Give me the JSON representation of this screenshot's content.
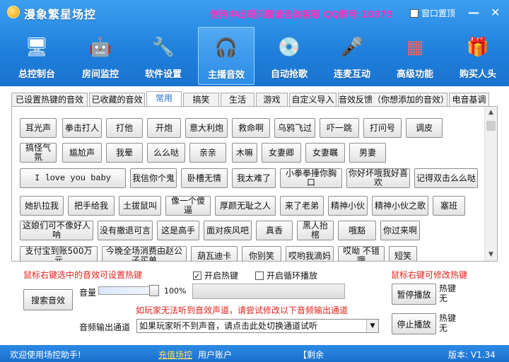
{
  "window": {
    "title": "漫象繁星场控",
    "notice": "使用中出现问题请咨询客服 QQ群号:10375",
    "topmost_label": "窗口置顶",
    "minimize": "—",
    "close": "✕"
  },
  "nav": [
    {
      "label": "总控制台",
      "icon": "🖥",
      "color": "#ffffff"
    },
    {
      "label": "房间监控",
      "icon": "🤖",
      "color": "#ffd44a"
    },
    {
      "label": "软件设置",
      "icon": "🔧",
      "color": "#ffcf3a"
    },
    {
      "label": "主播音效",
      "icon": "🎧",
      "color": "#ffffff"
    },
    {
      "label": "自动抢歌",
      "icon": "💿",
      "color": "#ffffff"
    },
    {
      "label": "连麦互动",
      "icon": "🎤",
      "color": "#ffffff"
    },
    {
      "label": "高级功能",
      "icon": "▦",
      "color": "#ff5a6a"
    },
    {
      "label": "购买人头",
      "icon": "🎁",
      "color": "#ffffff"
    }
  ],
  "tabs": [
    "已设置热键的音效",
    "已收藏的音效",
    "常用",
    "搞笑",
    "生活",
    "游戏",
    "自定义导入",
    "音效反馈（你想添加的音效）",
    "电音基调"
  ],
  "sounds": [
    [
      "耳光声",
      "拳击打人",
      "打他",
      "开炮",
      "意大利炮",
      "救命啊",
      "乌鸦飞过",
      "吓一跳",
      "打问号",
      "调皮"
    ],
    [
      "搞怪气氛",
      "尴尬声",
      "我晕",
      "么么哒",
      "亲亲",
      "木嘛",
      "女妻卿",
      "女妻瞩",
      "男妻"
    ],
    [
      "I love you baby",
      "我信你个鬼",
      "卧槽无情",
      "我太难了",
      "小拳拳捶你胸口",
      "你好坏哦我好喜欢",
      "记得双击么么哒"
    ],
    [
      "她扒拉我",
      "把手给我",
      "土拔鼠叫",
      "像一个傻逼",
      "厚颜无耻之人",
      "来了老弟",
      "精神小伙",
      "精神小伙之歌",
      "塞班"
    ],
    [
      "这娘们可不像好人呐",
      "没有撤退可言",
      "这是高手",
      "面对疾风吧",
      "真香",
      "黑人抬棺",
      "哦豁",
      "你过来啊"
    ],
    [
      "支付宝到账500万元",
      "今晚全场消费由赵公子买单",
      "葫瓦迪卡",
      "你别笑",
      "哎哟我滴妈",
      "哎呦 不错哦",
      "短笑"
    ]
  ],
  "controls": {
    "hotkey_hint": "鼠标右键选中的音效可设置热键",
    "enable_hotkey": "开启热键",
    "loop_play": "开启循环播放",
    "modify_hotkey_hint": "鼠标右键可修改热键",
    "search_button": "搜索音效",
    "volume_label": "音量",
    "volume_percent": "100%",
    "volume_value": 100,
    "channel_hint": "如玩家无法听到音效声道，请尝试修改以下音频输出通道",
    "output_label": "音频输出通道",
    "output_selected": "如果玩家听不到声音，请点击此处切换通道试听",
    "pause_button": "暂停播放",
    "stop_button": "停止播放",
    "hotkey_label": "热键",
    "hotkey_none": "无"
  },
  "status": {
    "welcome": "欢迎使用场控助手!",
    "recharge": "充值场控",
    "account": "用户账户",
    "remaining": "【剩余",
    "version": "版本: V1.34"
  }
}
